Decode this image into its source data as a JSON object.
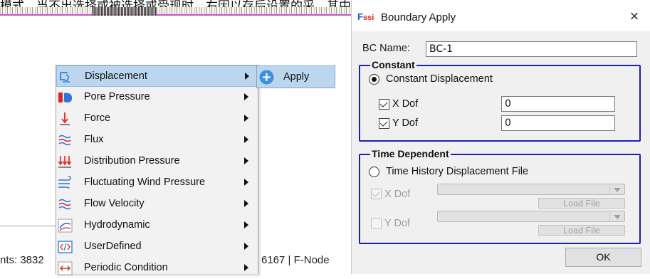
{
  "background": {
    "top_text": "模式，当不出选择或被选择或受现时，右因以存后设置的采，其中存",
    "status_left": "nts: 3832",
    "status_right": "6167 | F-Node"
  },
  "context_menu": {
    "items": [
      {
        "label": "Displacement",
        "icon": "displacement-icon",
        "highlighted": true
      },
      {
        "label": "Pore Pressure",
        "icon": "pore-pressure-icon"
      },
      {
        "label": "Force",
        "icon": "force-icon"
      },
      {
        "label": "Flux",
        "icon": "flux-icon"
      },
      {
        "label": "Distribution Pressure",
        "icon": "distribution-pressure-icon"
      },
      {
        "label": "Fluctuating Wind Pressure",
        "icon": "wind-pressure-icon"
      },
      {
        "label": "Flow Velocity",
        "icon": "flow-velocity-icon"
      },
      {
        "label": "Hydrodynamic",
        "icon": "hydrodynamic-icon"
      },
      {
        "label": "UserDefined",
        "icon": "user-defined-icon"
      },
      {
        "label": "Periodic Condition",
        "icon": "periodic-condition-icon"
      }
    ]
  },
  "submenu": {
    "apply_label": "Apply",
    "icon": "plus-circle-icon"
  },
  "dialog": {
    "logo_text": "Fssi",
    "title": "Boundary Apply",
    "close_glyph": "×",
    "bc_name_label": "BC Name:",
    "bc_name_value": "BC-1",
    "constant": {
      "title": "Constant",
      "radio_label": "Constant Displacement",
      "radio_checked": true,
      "x_dof_label": "X Dof",
      "x_dof_checked": true,
      "x_dof_value": "0",
      "y_dof_label": "Y Dof",
      "y_dof_checked": true,
      "y_dof_value": "0"
    },
    "time_dependent": {
      "title": "Time Dependent",
      "radio_label": "Time History Displacement File",
      "radio_checked": false,
      "x_dof_label": "X Dof",
      "x_dof_checked": true,
      "x_load_label": "Load File",
      "y_dof_label": "Y Dof",
      "y_dof_checked": false,
      "y_load_label": "Load File"
    },
    "ok_label": "OK"
  },
  "colors": {
    "menu_highlight": "#bcd6ef",
    "group_border": "#1c1fb3",
    "apply_icon_blue": "#3d8fe0",
    "mesh_magenta": "#d24fd3"
  }
}
